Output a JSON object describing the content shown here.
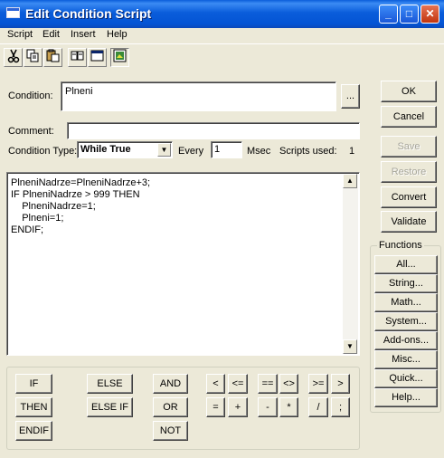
{
  "window": {
    "title": "Edit Condition Script",
    "minimize": "_",
    "maximize": "□",
    "close": "✕"
  },
  "menu": [
    "Script",
    "Edit",
    "Insert",
    "Help"
  ],
  "toolbar": {
    "icons": [
      "cut-icon",
      "copy-icon",
      "paste-icon",
      "find-icon",
      "window-icon",
      "picture-icon"
    ]
  },
  "form": {
    "condition_label": "Condition:",
    "condition_value": "Plneni",
    "browse_label": "...",
    "comment_label": "Comment:",
    "comment_value": "",
    "condition_type_label": "Condition Type:",
    "condition_type_value": "While True",
    "every_label": "Every",
    "every_value": "1",
    "msec_label": "Msec",
    "scripts_used_label": "Scripts used:",
    "scripts_used_value": "1"
  },
  "script_lines": [
    "PlneniNadrze=PlneniNadrze+3;",
    "IF PlneniNadrze > 999 THEN",
    "    PlneniNadrze=1;",
    "    Plneni=1;",
    "ENDIF;"
  ],
  "side_buttons": {
    "ok": "OK",
    "cancel": "Cancel",
    "save": "Save",
    "restore": "Restore",
    "convert": "Convert",
    "validate": "Validate"
  },
  "functions": {
    "label": "Functions",
    "buttons": [
      "All...",
      "String...",
      "Math...",
      "System...",
      "Add-ons...",
      "Misc...",
      "Quick...",
      "Help..."
    ]
  },
  "keywords": {
    "if": "IF",
    "then": "THEN",
    "endif": "ENDIF",
    "else": "ELSE",
    "else_if": "ELSE IF",
    "and": "AND",
    "or": "OR",
    "not": "NOT"
  },
  "operators": {
    "lt": "<",
    "le": "<=",
    "eq": "==",
    "ne": "<>",
    "ge": ">=",
    "gt": ">",
    "assign": "=",
    "plus": "+",
    "minus": "-",
    "mul": "*",
    "div": "/",
    "semi": ";"
  }
}
